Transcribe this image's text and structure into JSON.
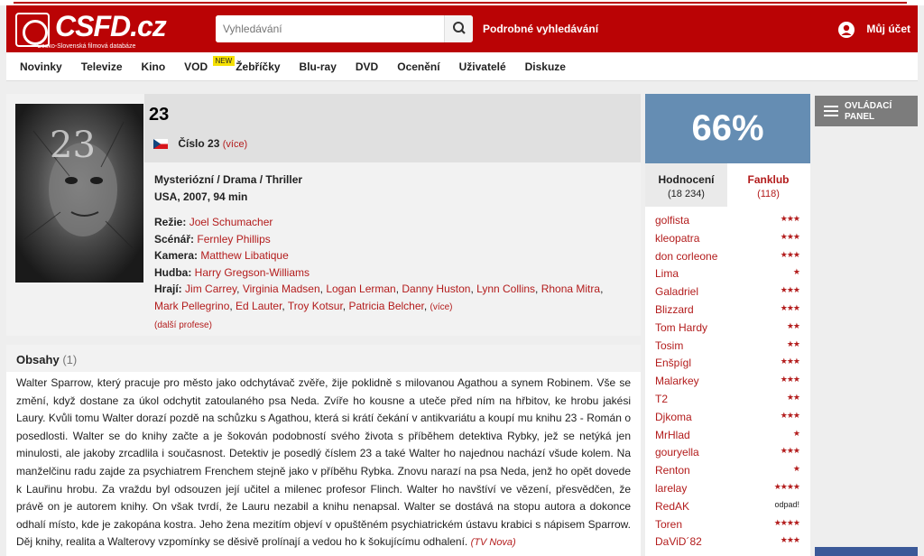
{
  "header": {
    "logo_text": "CSFD.cz",
    "logo_sub": "Česko-Slovenská filmová databáze",
    "search_placeholder": "Vyhledávání",
    "advanced_search": "Podrobné vyhledávání",
    "account": "Můj účet"
  },
  "nav": {
    "items": [
      "Novinky",
      "Televize",
      "Kino",
      "VOD",
      "Žebříčky",
      "Blu-ray",
      "DVD",
      "Ocenění",
      "Uživatelé",
      "Diskuze"
    ],
    "vod_badge": "NEW"
  },
  "film": {
    "title": "23",
    "original_title": "Číslo 23",
    "more": "(více)",
    "genres": "Mysteriózní / Drama / Thriller",
    "origin": "USA, 2007, 94 min",
    "director_label": "Režie:",
    "director": "Joel Schumacher",
    "writer_label": "Scénář:",
    "writer": "Fernley Phillips",
    "camera_label": "Kamera:",
    "camera": "Matthew Libatique",
    "music_label": "Hudba:",
    "music": "Harry Gregson-Williams",
    "cast_label": "Hrají:",
    "cast": [
      "Jim Carrey",
      "Virginia Madsen",
      "Logan Lerman",
      "Danny Huston",
      "Lynn Collins",
      "Rhona Mitra",
      "Mark Pellegrino",
      "Ed Lauter",
      "Troy Kotsur",
      "Patricia Belcher"
    ],
    "cast_more": "(více)",
    "more_professions": "(další profese)",
    "poster_number": "23"
  },
  "plot": {
    "title": "Obsahy",
    "count": "(1)",
    "text": "Walter Sparrow, který pracuje pro město jako odchytávač zvěře, žije poklidně s milovanou Agathou a synem Robinem. Vše se změní, když dostane za úkol odchytit zatoulaného psa Neda. Zvíře ho kousne a uteče před ním na hřbitov, ke hrobu jakési Laury. Kvůli tomu Walter dorazí pozdě na schůzku s Agathou, která si krátí čekání v antikvariátu a koupí mu knihu 23 - Román o posedlosti. Walter se do knihy začte a je šokován podobností svého života s příběhem detektiva Rybky, jež se netýká jen minulosti, ale jakoby zrcadlila i současnost. Detektiv je posedlý číslem 23 a také Walter ho najednou nachází všude kolem. Na manželčinu radu zajde za psychiatrem Frenchem stejně jako v příběhu Rybka. Znovu narazí na psa Neda, jenž ho opět dovede k Lauřinu hrobu. Za vraždu byl odsouzen její učitel a milenec profesor Flinch. Walter ho navštíví ve vězení, přesvědčen, že právě on je autorem knihy. On však tvrdí, že Lauru nezabil a knihu nenapsal. Walter se dostává na stopu autora a dokonce odhalí místo, kde je zakopána kostra. Jeho žena mezitím objeví v opuštěném psychiatrickém ústavu krabici s nápisem Sparrow. Děj knihy, realita a Walterovy vzpomínky se děsivě prolínají a vedou ho k šokujícímu odhalení.",
    "source": "(TV Nova)"
  },
  "rating": {
    "percent": "66%",
    "tab_ratings": "Hodnocení",
    "tab_ratings_count": "(18 234)",
    "tab_fanclub": "Fanklub",
    "tab_fanclub_count": "(118)",
    "raters": [
      {
        "name": "golfista",
        "stars": "★★★"
      },
      {
        "name": "kleopatra",
        "stars": "★★★"
      },
      {
        "name": "don corleone",
        "stars": "★★★"
      },
      {
        "name": "Lima",
        "stars": "★"
      },
      {
        "name": "Galadriel",
        "stars": "★★★"
      },
      {
        "name": "Blizzard",
        "stars": "★★★"
      },
      {
        "name": "Tom Hardy",
        "stars": "★★"
      },
      {
        "name": "Tosim",
        "stars": "★★"
      },
      {
        "name": "Enšpígl",
        "stars": "★★★"
      },
      {
        "name": "Malarkey",
        "stars": "★★★"
      },
      {
        "name": "T2",
        "stars": "★★"
      },
      {
        "name": "Djkoma",
        "stars": "★★★"
      },
      {
        "name": "MrHlad",
        "stars": "★"
      },
      {
        "name": "gouryella",
        "stars": "★★★"
      },
      {
        "name": "Renton",
        "stars": "★"
      },
      {
        "name": "larelay",
        "stars": "★★★★"
      },
      {
        "name": "RedAK",
        "stars": "odpad!"
      },
      {
        "name": "Toren",
        "stars": "★★★★"
      },
      {
        "name": "DaViD´82",
        "stars": "★★★"
      }
    ]
  },
  "control_panel": {
    "line1": "OVLÁDACÍ",
    "line2": "PANEL"
  },
  "colors": {
    "brand_red": "#ba0305",
    "link_red": "#b31c1c",
    "rating_blue": "#658db3"
  }
}
